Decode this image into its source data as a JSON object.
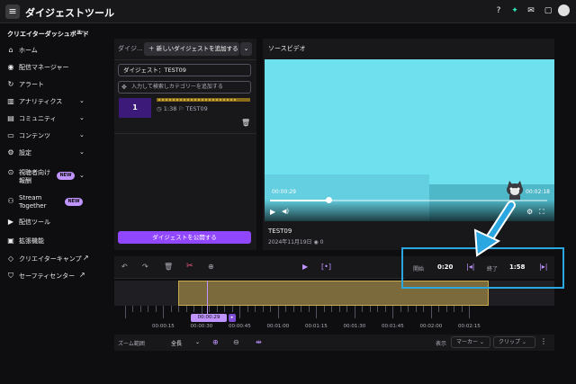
{
  "header": {
    "title": "ダイジェストツール",
    "icons": [
      "help-icon",
      "sparkle-icon",
      "inbox-icon",
      "chat-icon",
      "avatar"
    ]
  },
  "sidebar": {
    "title": "クリエイターダッシュボード",
    "items": [
      {
        "label": "ホーム",
        "icon": "home-icon",
        "chevron": false
      },
      {
        "label": "配信マネージャー",
        "icon": "broadcast-icon",
        "chevron": false
      },
      {
        "label": "アラート",
        "icon": "alert-icon",
        "chevron": false
      },
      {
        "label": "アナリティクス",
        "icon": "analytics-icon",
        "chevron": true
      },
      {
        "label": "コミュニティ",
        "icon": "community-icon",
        "chevron": true
      },
      {
        "label": "コンテンツ",
        "icon": "content-icon",
        "chevron": true
      },
      {
        "label": "設定",
        "icon": "settings-icon",
        "chevron": true
      },
      {
        "label": "視聴者向け",
        "label2": "報酬",
        "icon": "reward-icon",
        "chevron": true,
        "badge": "NEW"
      },
      {
        "label": "Stream",
        "label2": "Together",
        "icon": "people-icon",
        "chevron": false,
        "badge": "NEW"
      },
      {
        "label": "配信ツール",
        "icon": "camera-icon",
        "chevron": false
      },
      {
        "label": "拡張機能",
        "icon": "extension-icon",
        "chevron": false
      },
      {
        "label": "クリエイターキャンプ",
        "icon": "camp-icon",
        "external": true
      },
      {
        "label": "セーフティセンター",
        "icon": "shield-icon",
        "external": true
      }
    ]
  },
  "digest_panel": {
    "header": "ダイジ...",
    "add_button": "新しいダイジェストを追加する",
    "name_value": "ダイジェスト：TEST09",
    "category_placeholder": "入力して検索しカテゴリーを追加する",
    "clip": {
      "number": "1",
      "duration": "1:38",
      "title": "TEST09"
    },
    "publish_button": "ダイジェストを公開する"
  },
  "video_panel": {
    "title": "ソースビデオ",
    "current_time": "00:00:29",
    "total_time": "00:02:18",
    "progress": 0.21,
    "video_title": "TEST09",
    "video_date": "2024年11月19日",
    "views": "0"
  },
  "edit_controls": {
    "start_label": "開始",
    "start_value": "0:20",
    "end_label": "終了",
    "end_value": "1:58"
  },
  "timeline": {
    "playhead_time": "00:00:29",
    "ticks": [
      "00:00:15",
      "00:00:30",
      "00:00:45",
      "00:01:00",
      "00:01:15",
      "00:01:30",
      "00:01:45",
      "00:02:00",
      "00:02:15"
    ]
  },
  "zoom": {
    "label": "ズーム範囲",
    "value": "全長",
    "show_label": "表示",
    "marker_dropdown": "マーカー",
    "clip_dropdown": "クリップ"
  },
  "colors": {
    "accent": "#9147ff",
    "accent_light": "#bf94ff",
    "highlight_annotation": "#2aa7e0"
  }
}
